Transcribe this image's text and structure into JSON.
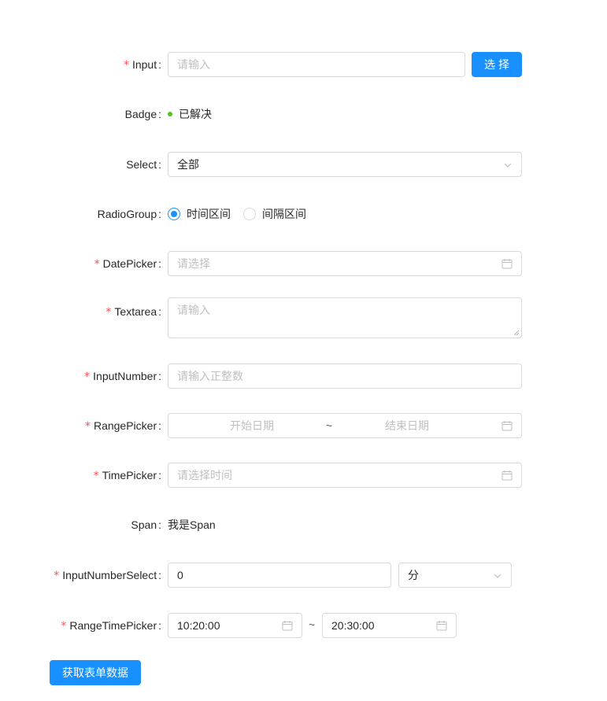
{
  "form": {
    "input": {
      "label": "Input",
      "required": true,
      "placeholder": "请输入",
      "button": "选择"
    },
    "badge": {
      "label": "Badge",
      "status_text": "已解决",
      "status_color": "#52c41a"
    },
    "select": {
      "label": "Select",
      "value": "全部"
    },
    "radio_group": {
      "label": "RadioGroup",
      "options": [
        "时间区间",
        "间隔区间"
      ],
      "selected": "时间区间"
    },
    "date_picker": {
      "label": "DatePicker",
      "required": true,
      "placeholder": "请选择"
    },
    "textarea": {
      "label": "Textarea",
      "required": true,
      "placeholder": "请输入"
    },
    "input_number": {
      "label": "InputNumber",
      "required": true,
      "placeholder": "请输入正整数"
    },
    "range_picker": {
      "label": "RangePicker",
      "required": true,
      "start_placeholder": "开始日期",
      "separator": "~",
      "end_placeholder": "结束日期"
    },
    "time_picker": {
      "label": "TimePicker",
      "required": true,
      "placeholder": "请选择时间"
    },
    "span": {
      "label": "Span",
      "text": "我是Span"
    },
    "input_number_select": {
      "label": "InputNumberSelect",
      "required": true,
      "value": "0",
      "unit": "分"
    },
    "range_time_picker": {
      "label": "RangeTimePicker",
      "required": true,
      "start": "10:20:00",
      "separator": "~",
      "end": "20:30:00"
    },
    "submit_button": "获取表单数据"
  },
  "colors": {
    "primary": "#1890ff",
    "required": "#ff4d4f",
    "border": "#d9d9d9",
    "placeholder": "#bfbfbf"
  },
  "icons": {
    "calendar": "calendar-icon",
    "chevron": "chevron-down-icon"
  }
}
